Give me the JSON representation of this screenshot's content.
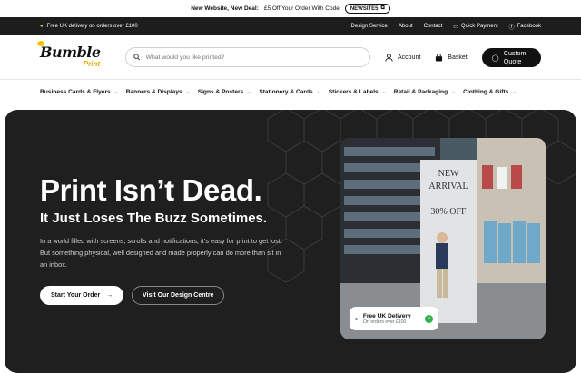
{
  "announcement": {
    "text": "New Website, New Deal:",
    "text2": "£5 Off Your Order With Code",
    "code": "NEWSITE5"
  },
  "topbar": {
    "delivery": "Free UK delivery on orders over £100",
    "links": [
      "Design Service",
      "About",
      "Contact",
      "Quick Payment",
      "Facebook"
    ]
  },
  "header": {
    "logo_main": "Bumble",
    "logo_sub": "Print",
    "search_placeholder": "What would you like printed?",
    "account": "Account",
    "basket": "Basket",
    "quote": "Custom Quote"
  },
  "nav": [
    "Business Cards & Flyers",
    "Banners & Displays",
    "Signs & Posters",
    "Stationery & Cards",
    "Stickers & Labels",
    "Retail & Packaging",
    "Clothing & Gifts"
  ],
  "hero": {
    "title": "Print Isn’t Dead.",
    "subtitle": "It Just Loses The Buzz Sometimes.",
    "body": "In a world filled with screens, scrolls and notifications, it’s easy for print to get lost. But something physical, well designed and made properly can do more than sit in an inbox.",
    "primary_button": "Start Your Order",
    "secondary_button": "Visit Our Design Centre",
    "banner_line1": "NEW",
    "banner_line2": "ARRIVAL",
    "banner_line3": "30% OFF",
    "delivery_title": "Free UK Delivery",
    "delivery_sub": "On orders over £100"
  },
  "colors": {
    "brand_yellow": "#f5c400",
    "dark": "#1f1f1f",
    "success": "#2fb34a"
  }
}
